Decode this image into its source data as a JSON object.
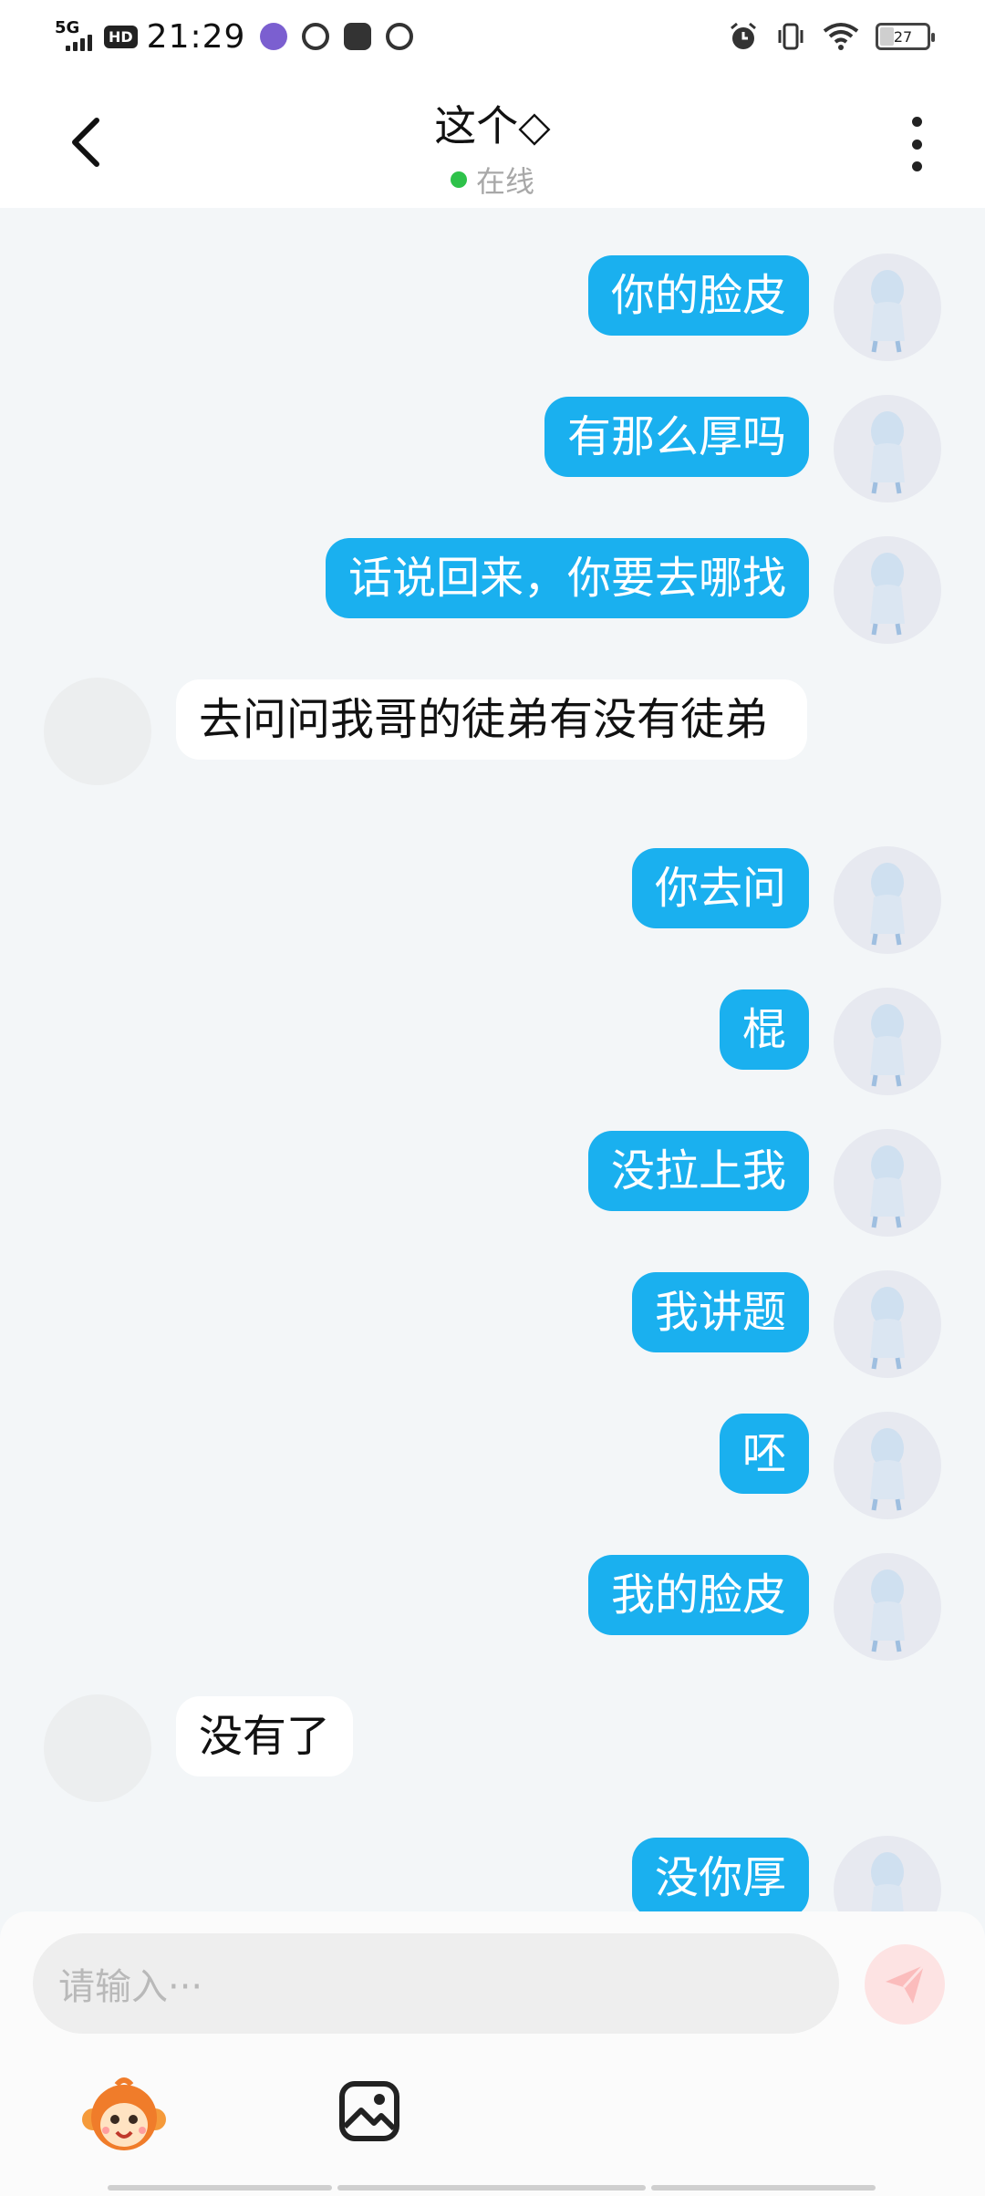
{
  "status_bar": {
    "network": "5G",
    "hd": "HD",
    "time": "21:29",
    "battery": "27",
    "battery_level_percent": 27
  },
  "header": {
    "title": "这个◇",
    "status": "在线",
    "status_color": "#2ec24a"
  },
  "colors": {
    "my_bubble": "#1ab0ef",
    "their_bubble": "#ffffff",
    "background": "#f3f6f8"
  },
  "messages": [
    {
      "sender": "me",
      "text": "你的脸皮"
    },
    {
      "sender": "me",
      "text": "有那么厚吗"
    },
    {
      "sender": "me",
      "text": "话说回来，你要去哪找"
    },
    {
      "sender": "them",
      "text": "去问问我哥的徒弟有没有徒弟"
    },
    {
      "sender": "me",
      "text": "你去问"
    },
    {
      "sender": "me",
      "text": "棍"
    },
    {
      "sender": "me",
      "text": "没拉上我"
    },
    {
      "sender": "me",
      "text": "我讲题"
    },
    {
      "sender": "me",
      "text": "呸"
    },
    {
      "sender": "me",
      "text": "我的脸皮"
    },
    {
      "sender": "them",
      "text": "没有了"
    },
    {
      "sender": "me",
      "text": "没你厚"
    }
  ],
  "input": {
    "placeholder": "请输入···"
  },
  "icons": {
    "back": "chevron-left-icon",
    "more": "more-vertical-icon",
    "send": "send-icon",
    "emoji": "monkey-emoji-icon",
    "image": "image-icon"
  }
}
